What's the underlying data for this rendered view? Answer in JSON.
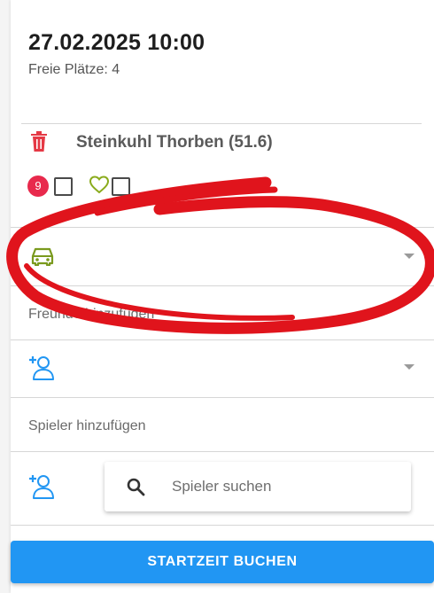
{
  "booking": {
    "datetime": "27.02.2025 10:00",
    "free_slots": "Freie Plätze: 4"
  },
  "player": {
    "name": "Steinkuhl Thorben (51.6)",
    "badge_count": "9"
  },
  "friends_section": {
    "label": "Freunde hinzufügen"
  },
  "players_section": {
    "label": "Spieler hinzufügen"
  },
  "search": {
    "placeholder": "Spieler suchen"
  },
  "actions": {
    "book_label": "STARTZEIT BUCHEN"
  },
  "colors": {
    "primary": "#2196f3",
    "delete_red": "#e53945",
    "badge_red": "#e8294c",
    "cart_green": "#7a9a1e",
    "person_blue": "#2196f3",
    "annotation_red": "#e0141c"
  },
  "icons": [
    "trash-icon",
    "heart-icon",
    "car-icon",
    "add-person-icon",
    "search-icon",
    "caret-down-icon"
  ]
}
